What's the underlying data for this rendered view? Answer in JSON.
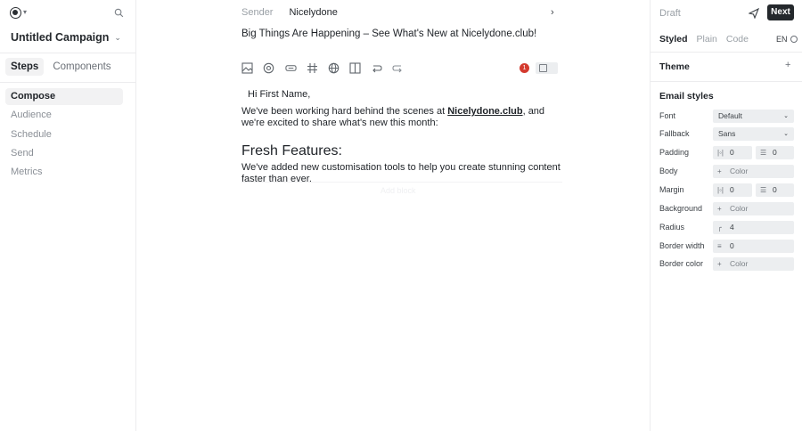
{
  "left": {
    "campaign_name": "Untitled Campaign",
    "tabs": [
      {
        "label": "Steps",
        "active": true
      },
      {
        "label": "Components",
        "active": false
      }
    ],
    "steps": [
      {
        "label": "Compose",
        "active": true
      },
      {
        "label": "Audience",
        "active": false
      },
      {
        "label": "Schedule",
        "active": false
      },
      {
        "label": "Send",
        "active": false
      },
      {
        "label": "Metrics",
        "active": false
      }
    ]
  },
  "editor": {
    "sender_label": "Sender",
    "sender_value": "Nicelydone",
    "subject": "Big Things Are Happening – See What's New at Nicelydone.club!",
    "issue_count": "1",
    "greeting": "Hi First Name,",
    "para1_before": "We've been working hard behind the scenes at ",
    "para1_link": "Nicelydone.club",
    "para1_after": ", and we're excited to share what's new this month:",
    "heading": "Fresh Features:",
    "para2": "We've added new customisation tools to help you create stunning content faster than ever.",
    "ghost_block": "Add block",
    "toolbar_icons": [
      "image-icon",
      "mention-icon",
      "button-icon",
      "hash-icon",
      "globe-icon",
      "columns-icon",
      "undo-icon",
      "redo-icon"
    ]
  },
  "right": {
    "status": "Draft",
    "next_label": "Next",
    "mode_tabs": [
      {
        "label": "Styled",
        "active": true
      },
      {
        "label": "Plain",
        "active": false
      },
      {
        "label": "Code",
        "active": false
      }
    ],
    "lang": "EN",
    "theme_label": "Theme",
    "email_styles_label": "Email styles",
    "font_label": "Font",
    "font_value": "Default",
    "fallback_label": "Fallback",
    "fallback_value": "Sans",
    "padding_label": "Padding",
    "padding_h": "0",
    "padding_v": "0",
    "body_label": "Body",
    "body_color": "Color",
    "margin_label": "Margin",
    "margin_h": "0",
    "margin_v": "0",
    "background_label": "Background",
    "background_color": "Color",
    "radius_label": "Radius",
    "radius_value": "4",
    "border_width_label": "Border width",
    "border_width_value": "0",
    "border_color_label": "Border color",
    "border_color_value": "Color"
  },
  "colors": {
    "accent_dark": "#24282c",
    "badge_red": "#d43b2f",
    "muted": "#9aa0a6"
  }
}
